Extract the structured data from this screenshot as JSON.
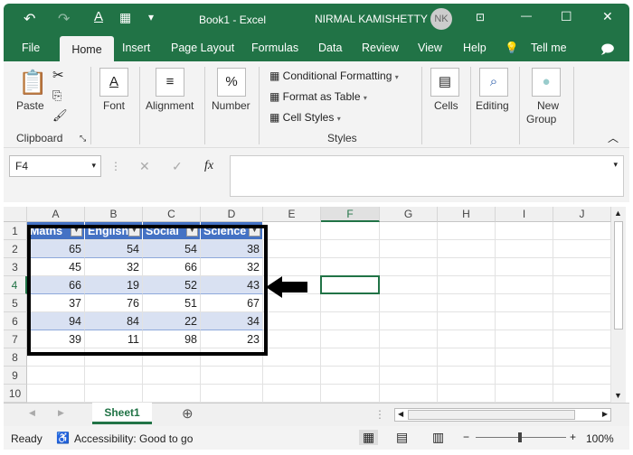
{
  "titlebar": {
    "title": "Book1 - Excel",
    "user": "NIRMAL KAMISHETTY",
    "initials": "NK"
  },
  "tabs": [
    "File",
    "Home",
    "Insert",
    "Page Layout",
    "Formulas",
    "Data",
    "Review",
    "View",
    "Help",
    "Tell me"
  ],
  "ribbon": {
    "paste": "Paste",
    "clipboard": "Clipboard",
    "font": "Font",
    "alignment": "Alignment",
    "number": "Number",
    "cond_format": "Conditional Formatting",
    "format_table": "Format as Table",
    "cell_styles": "Cell Styles",
    "styles": "Styles",
    "cells": "Cells",
    "editing": "Editing",
    "new_group_1": "New",
    "new_group_2": "Group",
    "percent": "%"
  },
  "formula": {
    "name_box": "F4",
    "value": "",
    "fx": "fx"
  },
  "columns": [
    "A",
    "B",
    "C",
    "D",
    "E",
    "F",
    "G",
    "H",
    "I",
    "J"
  ],
  "rows": [
    "1",
    "2",
    "3",
    "4",
    "5",
    "6",
    "7",
    "8",
    "9",
    "10"
  ],
  "table": {
    "headers": [
      "Maths",
      "English",
      "Social",
      "Science"
    ],
    "data": [
      [
        "65",
        "54",
        "54",
        "38"
      ],
      [
        "45",
        "32",
        "66",
        "32"
      ],
      [
        "66",
        "19",
        "52",
        "43"
      ],
      [
        "37",
        "76",
        "51",
        "67"
      ],
      [
        "94",
        "84",
        "22",
        "34"
      ],
      [
        "39",
        "11",
        "98",
        "23"
      ]
    ]
  },
  "selected_cell": "F4",
  "sheet": {
    "tab": "Sheet1"
  },
  "status": {
    "ready": "Ready",
    "accessibility": "Accessibility: Good to go",
    "zoom": "100%"
  },
  "colors": {
    "excel_green": "#217346",
    "table_header": "#4472c4",
    "band": "#d9e1f2"
  }
}
